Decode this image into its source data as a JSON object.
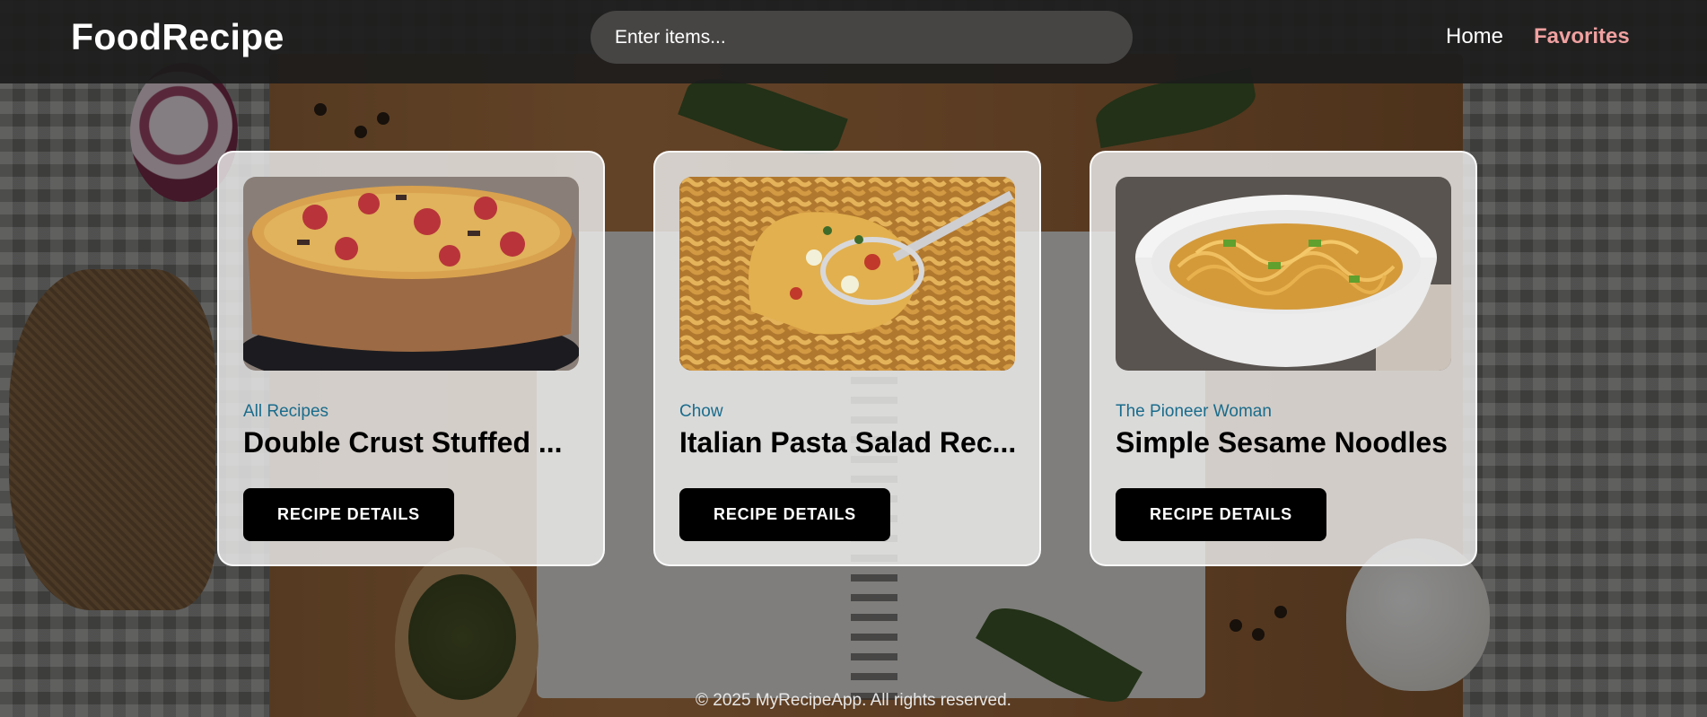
{
  "header": {
    "logo": "FoodRecipe",
    "search_placeholder": "Enter items...",
    "nav": {
      "home": "Home",
      "favorites": "Favorites"
    }
  },
  "recipes": [
    {
      "source": "All Recipes",
      "title": "Double Crust Stuffed ...",
      "button": "RECIPE DETAILS",
      "image": "stuffed-pizza-pie"
    },
    {
      "source": "Chow",
      "title": "Italian Pasta Salad Rec...",
      "button": "RECIPE DETAILS",
      "image": "pasta-salad"
    },
    {
      "source": "The Pioneer Woman",
      "title": "Simple Sesame Noodles",
      "button": "RECIPE DETAILS",
      "image": "sesame-noodles"
    }
  ],
  "footer": {
    "text": "© 2025 MyRecipeApp. All rights reserved."
  },
  "colors": {
    "header_bg": "#1c1c1c",
    "favorites_link": "#f0a0a0",
    "source_text": "#1a6c8c",
    "button_bg": "#000000"
  }
}
